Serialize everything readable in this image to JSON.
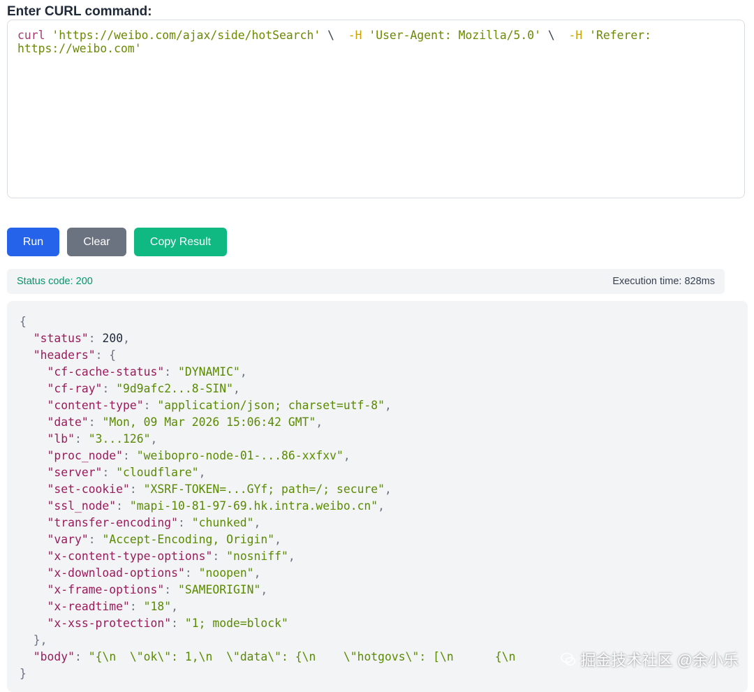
{
  "label": "Enter CURL command:",
  "curl": {
    "cmd": "curl",
    "url": "'https://weibo.com/ajax/side/hotSearch'",
    "sep1": " \\  ",
    "flag1": "-H",
    "header1": "'User-Agent: Mozilla/5.0'",
    "sep2": " \\  ",
    "flag2": "-H",
    "header2": "'Referer: https://weibo.com'"
  },
  "buttons": {
    "run": "Run",
    "clear": "Clear",
    "copy": "Copy Result"
  },
  "status": {
    "code_text": "Status code: 200",
    "time_text": "Execution time: 828ms"
  },
  "result": {
    "status_key": "\"status\"",
    "status_val": "200",
    "headers_key": "\"headers\"",
    "headers": [
      {
        "k": "\"cf-cache-status\"",
        "v": "\"DYNAMIC\""
      },
      {
        "k": "\"cf-ray\"",
        "v": "\"9d9afc2...8-SIN\""
      },
      {
        "k": "\"content-type\"",
        "v": "\"application/json; charset=utf-8\""
      },
      {
        "k": "\"date\"",
        "v": "\"Mon, 09 Mar 2026 15:06:42 GMT\""
      },
      {
        "k": "\"lb\"",
        "v": "\"3...126\""
      },
      {
        "k": "\"proc_node\"",
        "v": "\"weibopro-node-01-...86-xxfxv\""
      },
      {
        "k": "\"server\"",
        "v": "\"cloudflare\""
      },
      {
        "k": "\"set-cookie\"",
        "v": "\"XSRF-TOKEN=...GYf; path=/; secure\""
      },
      {
        "k": "\"ssl_node\"",
        "v": "\"mapi-10-81-97-69.hk.intra.weibo.cn\""
      },
      {
        "k": "\"transfer-encoding\"",
        "v": "\"chunked\""
      },
      {
        "k": "\"vary\"",
        "v": "\"Accept-Encoding, Origin\""
      },
      {
        "k": "\"x-content-type-options\"",
        "v": "\"nosniff\""
      },
      {
        "k": "\"x-download-options\"",
        "v": "\"noopen\""
      },
      {
        "k": "\"x-frame-options\"",
        "v": "\"SAMEORIGIN\""
      },
      {
        "k": "\"x-readtime\"",
        "v": "\"18\""
      },
      {
        "k": "\"x-xss-protection\"",
        "v": "\"1; mode=block\""
      }
    ],
    "body_key": "\"body\"",
    "body_val": "\"{\\n  \\\"ok\\\": 1,\\n  \\\"data\\\": {\\n    \\\"hotgovs\\\": [\\n      {\\n"
  },
  "watermark": "掘金技术社区 @余小乐"
}
